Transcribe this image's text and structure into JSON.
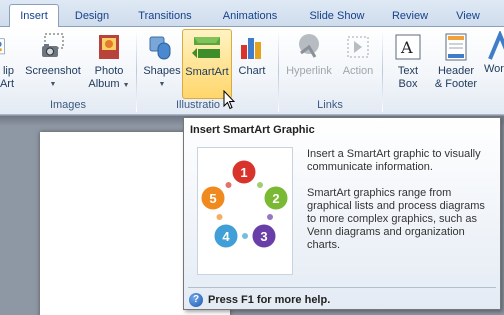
{
  "tabs": [
    {
      "label": "Insert",
      "active": true
    },
    {
      "label": "Design"
    },
    {
      "label": "Transitions"
    },
    {
      "label": "Animations"
    },
    {
      "label": "Slide Show"
    },
    {
      "label": "Review"
    },
    {
      "label": "View"
    }
  ],
  "ribbon": {
    "clip_art": {
      "line1": "lip",
      "line2": "Art"
    },
    "screenshot": {
      "label": "Screenshot"
    },
    "photo_album": {
      "line1": "Photo",
      "line2": "Album"
    },
    "images_group": "Images",
    "shapes": "Shapes",
    "smartart": "SmartArt",
    "chart": "Chart",
    "illustrations_group": "Illustratio",
    "hyperlink": "Hyperlink",
    "action": "Action",
    "links_group": "Links",
    "text_box": {
      "line1": "Text",
      "line2": "Box"
    },
    "header_footer": {
      "line1": "Header",
      "line2": "& Footer"
    },
    "wordart": "Wor"
  },
  "tooltip": {
    "title": "Insert SmartArt Graphic",
    "para1": "Insert a SmartArt graphic to visually communicate information.",
    "para2": "SmartArt graphics range from graphical lists and process diagrams to more complex graphics, such as Venn diagrams and organization charts.",
    "help": "Press F1 for more help.",
    "diagram_numbers": [
      "1",
      "2",
      "3",
      "4",
      "5"
    ],
    "diagram_colors": [
      "#d9342b",
      "#79b934",
      "#6a3ea8",
      "#3f9fd6",
      "#f08a1e"
    ]
  }
}
